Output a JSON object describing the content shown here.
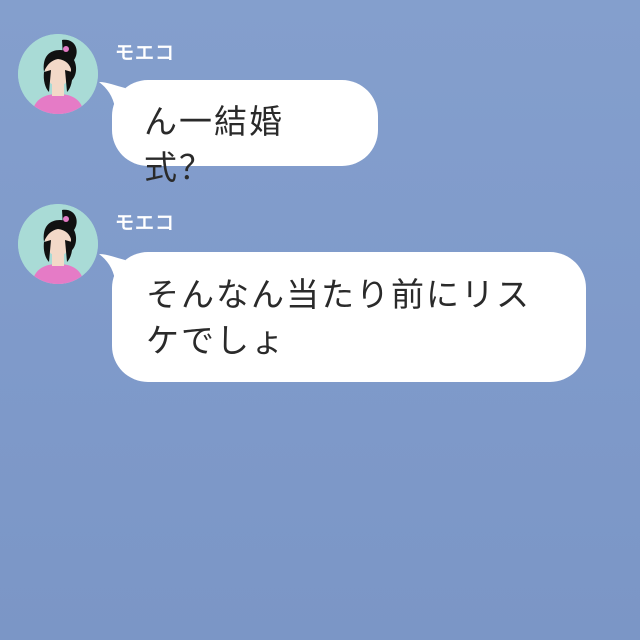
{
  "messages": [
    {
      "sender": "モエコ",
      "avatar_icon": "woman-ponytail-icon",
      "text": "ん一結婚式？"
    },
    {
      "sender": "モエコ",
      "avatar_icon": "woman-ponytail-icon",
      "text": "そんなん当たり前にリスケでしょ"
    }
  ],
  "colors": {
    "background": "#7e99c9",
    "bubble": "#ffffff",
    "avatar_bg": "#a9dbd6",
    "avatar_shirt": "#e57bc6"
  }
}
